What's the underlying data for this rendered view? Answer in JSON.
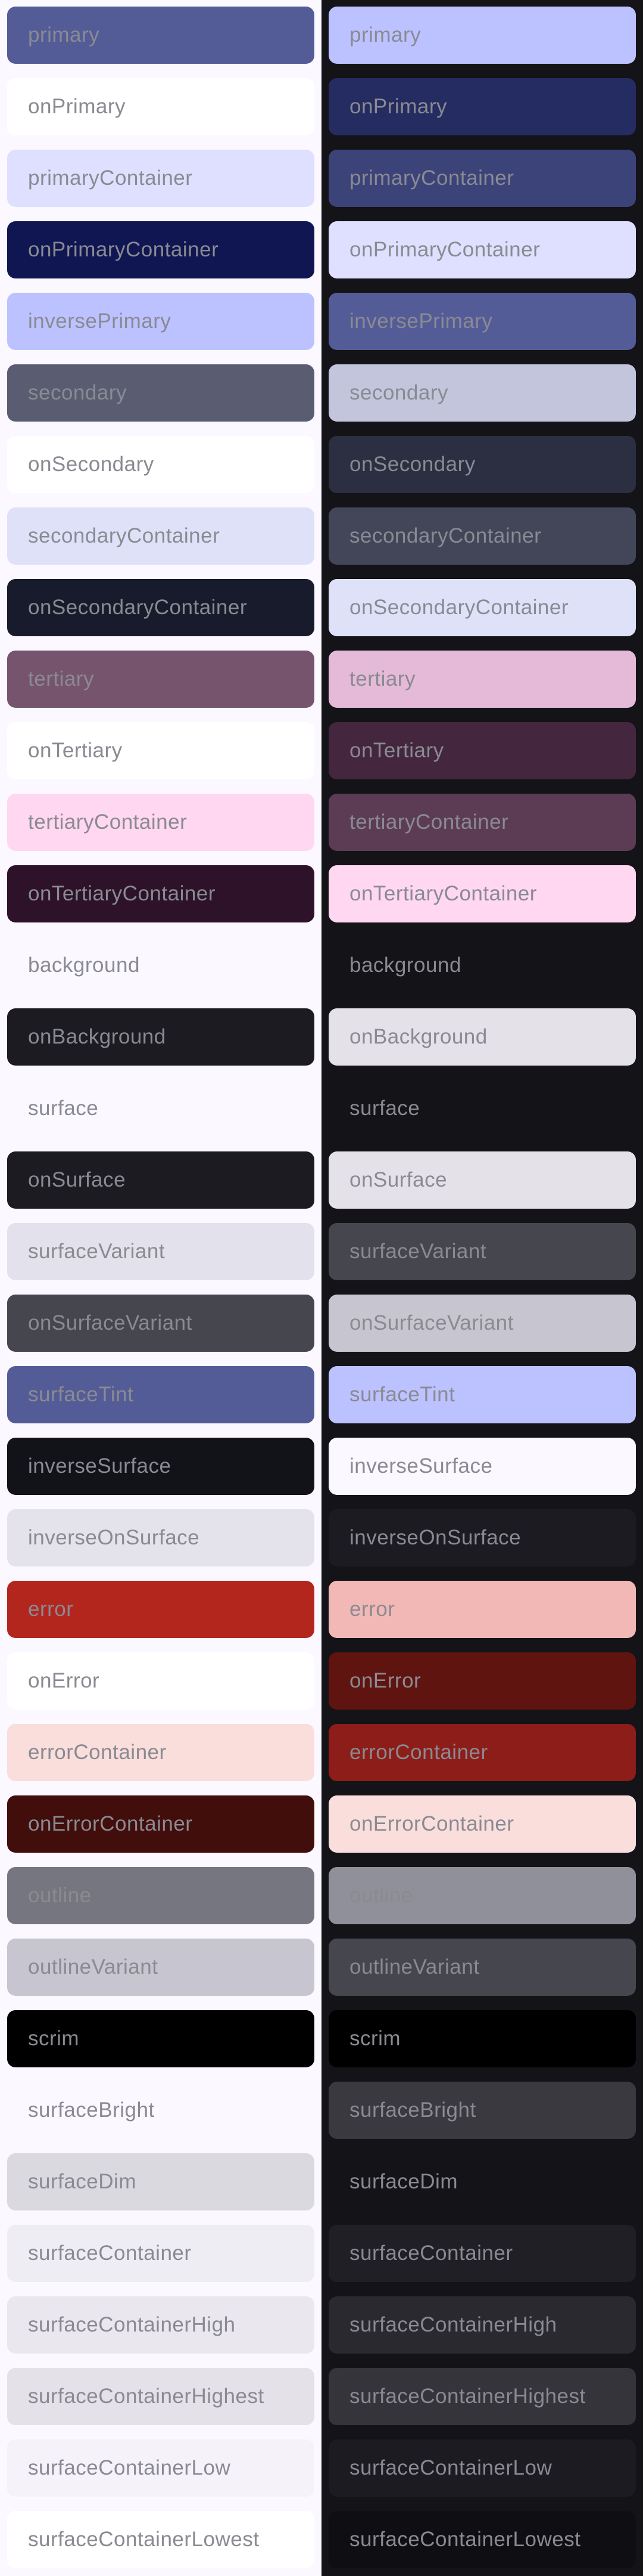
{
  "light": [
    {
      "label": "primary",
      "color": "#545c97"
    },
    {
      "label": "onPrimary",
      "color": "#ffffff"
    },
    {
      "label": "primaryContainer",
      "color": "#dfe0ff"
    },
    {
      "label": "onPrimaryContainer",
      "color": "#0f1652"
    },
    {
      "label": "inversePrimary",
      "color": "#bcc2ff"
    },
    {
      "label": "secondary",
      "color": "#5a5d72"
    },
    {
      "label": "onSecondary",
      "color": "#ffffff"
    },
    {
      "label": "secondaryContainer",
      "color": "#dfe1f9"
    },
    {
      "label": "onSecondaryContainer",
      "color": "#171b2c"
    },
    {
      "label": "tertiary",
      "color": "#76546e"
    },
    {
      "label": "onTertiary",
      "color": "#ffffff"
    },
    {
      "label": "tertiaryContainer",
      "color": "#ffd7f1"
    },
    {
      "label": "onTertiaryContainer",
      "color": "#2d1229"
    },
    {
      "label": "background",
      "color": "#fbf8ff"
    },
    {
      "label": "onBackground",
      "color": "#1b1b21"
    },
    {
      "label": "surface",
      "color": "#fbf8ff"
    },
    {
      "label": "onSurface",
      "color": "#1b1b21"
    },
    {
      "label": "surfaceVariant",
      "color": "#e3e1ec"
    },
    {
      "label": "onSurfaceVariant",
      "color": "#46464f"
    },
    {
      "label": "surfaceTint",
      "color": "#545c97"
    },
    {
      "label": "inverseSurface",
      "color": "#121319"
    },
    {
      "label": "inverseOnSurface",
      "color": "#e4e3eb"
    },
    {
      "label": "error",
      "color": "#b3261e"
    },
    {
      "label": "onError",
      "color": "#ffffff"
    },
    {
      "label": "errorContainer",
      "color": "#f9dedc"
    },
    {
      "label": "onErrorContainer",
      "color": "#410e0b"
    },
    {
      "label": "outline",
      "color": "#767680"
    },
    {
      "label": "outlineVariant",
      "color": "#c7c5d0"
    },
    {
      "label": "scrim",
      "color": "#000000"
    },
    {
      "label": "surfaceBright",
      "color": "#fbf8ff"
    },
    {
      "label": "surfaceDim",
      "color": "#dbd9e0"
    },
    {
      "label": "surfaceContainer",
      "color": "#efedf4"
    },
    {
      "label": "surfaceContainerHigh",
      "color": "#eae7ef"
    },
    {
      "label": "surfaceContainerHighest",
      "color": "#e4e1e9"
    },
    {
      "label": "surfaceContainerLow",
      "color": "#f5f2fa"
    },
    {
      "label": "surfaceContainerLowest",
      "color": "#ffffff"
    }
  ],
  "dark": [
    {
      "label": "primary",
      "color": "#bcc2ff"
    },
    {
      "label": "onPrimary",
      "color": "#252c61"
    },
    {
      "label": "primaryContainer",
      "color": "#3c4379"
    },
    {
      "label": "onPrimaryContainer",
      "color": "#dfe0ff"
    },
    {
      "label": "inversePrimary",
      "color": "#545c97"
    },
    {
      "label": "secondary",
      "color": "#c3c5dd"
    },
    {
      "label": "onSecondary",
      "color": "#2c2f42"
    },
    {
      "label": "secondaryContainer",
      "color": "#434659"
    },
    {
      "label": "onSecondaryContainer",
      "color": "#dfe1f9"
    },
    {
      "label": "tertiary",
      "color": "#e5bad8"
    },
    {
      "label": "onTertiary",
      "color": "#44263e"
    },
    {
      "label": "tertiaryContainer",
      "color": "#5c3c55"
    },
    {
      "label": "onTertiaryContainer",
      "color": "#ffd7f1"
    },
    {
      "label": "background",
      "color": "#131318"
    },
    {
      "label": "onBackground",
      "color": "#e4e1e9"
    },
    {
      "label": "surface",
      "color": "#131318"
    },
    {
      "label": "onSurface",
      "color": "#e4e1e9"
    },
    {
      "label": "surfaceVariant",
      "color": "#46464f"
    },
    {
      "label": "onSurfaceVariant",
      "color": "#c7c5d0"
    },
    {
      "label": "surfaceTint",
      "color": "#bcc2ff"
    },
    {
      "label": "inverseSurface",
      "color": "#fbf8ff"
    },
    {
      "label": "inverseOnSurface",
      "color": "#1b1b21"
    },
    {
      "label": "error",
      "color": "#f2b8b5"
    },
    {
      "label": "onError",
      "color": "#601410"
    },
    {
      "label": "errorContainer",
      "color": "#8c1d18"
    },
    {
      "label": "onErrorContainer",
      "color": "#f9dedc"
    },
    {
      "label": "outline",
      "color": "#90909a"
    },
    {
      "label": "outlineVariant",
      "color": "#46464f"
    },
    {
      "label": "scrim",
      "color": "#000000"
    },
    {
      "label": "surfaceBright",
      "color": "#39393f"
    },
    {
      "label": "surfaceDim",
      "color": "#131318"
    },
    {
      "label": "surfaceContainer",
      "color": "#1f1f25"
    },
    {
      "label": "surfaceContainerHigh",
      "color": "#29292f"
    },
    {
      "label": "surfaceContainerHighest",
      "color": "#34343a"
    },
    {
      "label": "surfaceContainerLow",
      "color": "#1b1b21"
    },
    {
      "label": "surfaceContainerLowest",
      "color": "#0e0e13"
    }
  ]
}
